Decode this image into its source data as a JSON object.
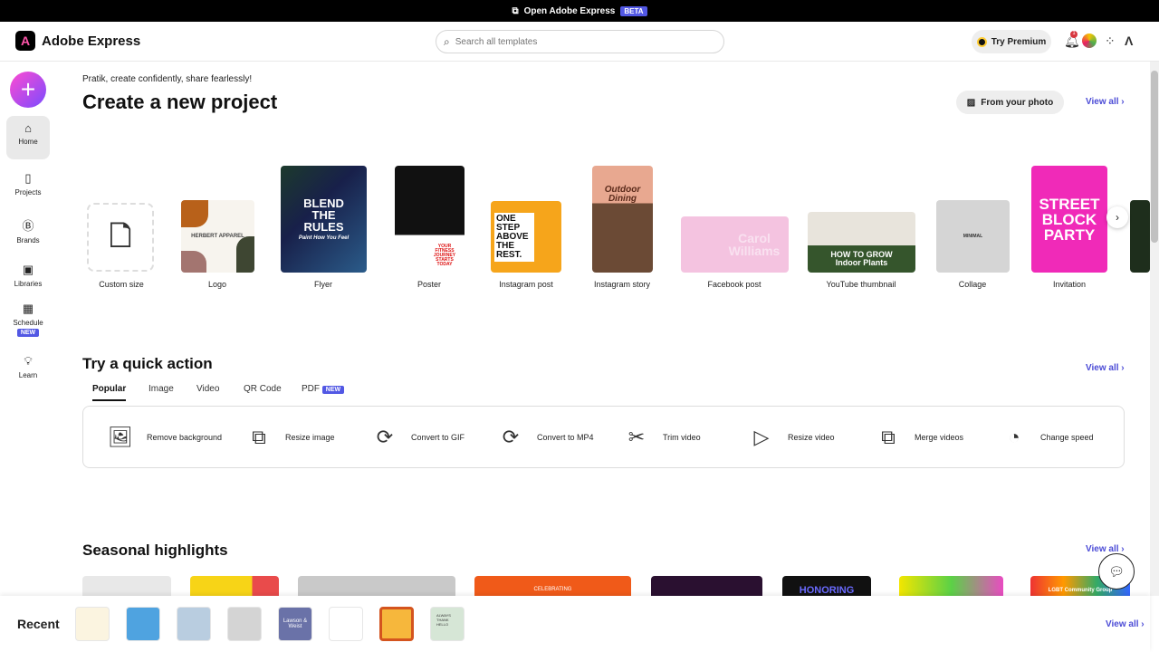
{
  "topbar": {
    "label": "Open Adobe Express",
    "badge": "BETA"
  },
  "header": {
    "brand": "Adobe Express",
    "search_placeholder": "Search all templates",
    "premium": "Try Premium",
    "notif_count": "1"
  },
  "sidebar": {
    "items": [
      {
        "label": "Home"
      },
      {
        "label": "Projects"
      },
      {
        "label": "Brands"
      },
      {
        "label": "Libraries"
      },
      {
        "label": "Schedule",
        "badge": "NEW"
      },
      {
        "label": "Learn"
      }
    ]
  },
  "create": {
    "greeting": "Pratik, create confidently, share fearlessly!",
    "title": "Create a new project",
    "from_photo": "From your photo",
    "view_all": "View all",
    "templates": [
      {
        "label": "Custom size"
      },
      {
        "label": "Logo",
        "art": "HERBERT APPAREL"
      },
      {
        "label": "Flyer",
        "art": "BLEND THE RULES",
        "sub": "Paint How You Feel"
      },
      {
        "label": "Poster",
        "art": "YOUR FITNESS JOURNEY STARTS TODAY"
      },
      {
        "label": "Instagram post",
        "art": "ONE STEP ABOVE THE REST."
      },
      {
        "label": "Instagram story",
        "art": "Outdoor Dining"
      },
      {
        "label": "Facebook post",
        "art": "Carol Williams"
      },
      {
        "label": "YouTube thumbnail",
        "art": "HOW TO GROW Indoor Plants"
      },
      {
        "label": "Collage",
        "art": "MINIMAL"
      },
      {
        "label": "Invitation",
        "art": "STREET BLOCK PARTY"
      }
    ]
  },
  "quick": {
    "title": "Try a quick action",
    "view_all": "View all",
    "tabs": [
      "Popular",
      "Image",
      "Video",
      "QR Code",
      "PDF"
    ],
    "pdf_badge": "NEW",
    "actions": [
      {
        "label": "Remove background",
        "icon": "image-icon"
      },
      {
        "label": "Resize image",
        "icon": "resize-image-icon"
      },
      {
        "label": "Convert to GIF",
        "icon": "convert-gif-icon"
      },
      {
        "label": "Convert to MP4",
        "icon": "convert-mp4-icon"
      },
      {
        "label": "Trim video",
        "icon": "trim-icon"
      },
      {
        "label": "Resize video",
        "icon": "resize-video-icon"
      },
      {
        "label": "Merge videos",
        "icon": "merge-icon"
      },
      {
        "label": "Change speed",
        "icon": "speed-icon"
      }
    ]
  },
  "seasonal": {
    "title": "Seasonal highlights",
    "view_all": "View all",
    "cards": [
      "",
      "",
      "",
      "CELEBRATING",
      "",
      "HONORING",
      "",
      "LGBT Community Group"
    ]
  },
  "recent": {
    "title": "Recent",
    "view_all": "View all",
    "thumbs": [
      "",
      "",
      "",
      "",
      "Lawson & Weist",
      "",
      "",
      "ALWAYS THANK HELLO"
    ]
  },
  "colors": {
    "accent": "#5258e4",
    "link": "#4b4bd6"
  }
}
